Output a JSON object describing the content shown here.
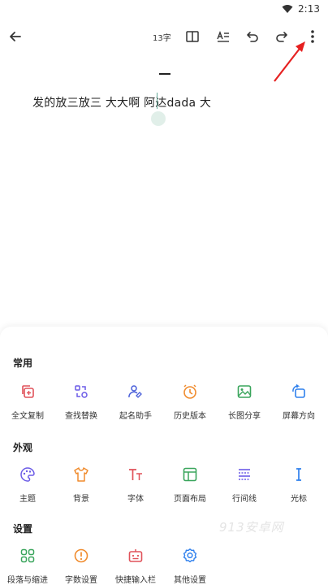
{
  "status_bar": {
    "time": "2:13"
  },
  "toolbar": {
    "word_count": "13字"
  },
  "editor": {
    "content": "发的放三放三 大大啊 阿达dada  大"
  },
  "sections": [
    {
      "title": "常用",
      "items": [
        {
          "label": "全文复制",
          "icon": "copy-icon",
          "color": "#e0525a"
        },
        {
          "label": "查找替换",
          "icon": "find-replace-icon",
          "color": "#6c5ce7"
        },
        {
          "label": "起名助手",
          "icon": "naming-assistant-icon",
          "color": "#4a5fd9"
        },
        {
          "label": "历史版本",
          "icon": "history-clock-icon",
          "color": "#f08c2e"
        },
        {
          "label": "长图分享",
          "icon": "image-share-icon",
          "color": "#3aa55c"
        },
        {
          "label": "屏幕方向",
          "icon": "screen-rotate-icon",
          "color": "#2f80ed"
        }
      ]
    },
    {
      "title": "外观",
      "items": [
        {
          "label": "主题",
          "icon": "palette-icon",
          "color": "#6c5ce7"
        },
        {
          "label": "背景",
          "icon": "shirt-icon",
          "color": "#f08c2e"
        },
        {
          "label": "字体",
          "icon": "font-icon",
          "color": "#e0525a"
        },
        {
          "label": "页面布局",
          "icon": "layout-icon",
          "color": "#3aa55c"
        },
        {
          "label": "行间线",
          "icon": "line-spacing-icon",
          "color": "#6c5ce7"
        },
        {
          "label": "光标",
          "icon": "text-cursor-icon",
          "color": "#2f80ed"
        }
      ]
    },
    {
      "title": "设置",
      "items": [
        {
          "label": "段落与缩进",
          "icon": "paragraph-grid-icon",
          "color": "#3aa55c"
        },
        {
          "label": "字数设置",
          "icon": "alert-circle-icon",
          "color": "#f08c2e"
        },
        {
          "label": "快捷输入栏",
          "icon": "quick-input-icon",
          "color": "#e0525a"
        },
        {
          "label": "其他设置",
          "icon": "settings-gear-icon",
          "color": "#2f80ed"
        }
      ]
    }
  ],
  "watermark": "913安卓网"
}
